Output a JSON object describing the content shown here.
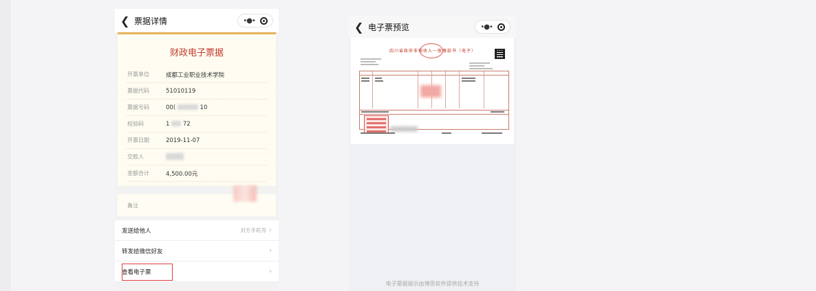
{
  "phone1": {
    "nav": {
      "back_icon": "chevron-left",
      "title": "票据详情"
    },
    "receipt": {
      "title": "财政电子票据",
      "fields": [
        {
          "label": "开票单位",
          "value": "成都工业职业技术学院"
        },
        {
          "label": "票据代码",
          "value": "51010119"
        },
        {
          "label": "票据号码",
          "value_prefix": "00(",
          "value_suffix": "10"
        },
        {
          "label": "校验码",
          "value_prefix": "1",
          "value_suffix": "72"
        },
        {
          "label": "开票日期",
          "value": "2019-11-07"
        },
        {
          "label": "交款人",
          "value": ""
        },
        {
          "label": "金额合计",
          "value": "4,500.00元"
        }
      ],
      "remark_label": "备注"
    },
    "menu": [
      {
        "label": "发送给他人",
        "hint": "对方手机号"
      },
      {
        "label": "转发给微信好友",
        "hint": ""
      },
      {
        "label": "查看电子票",
        "hint": ""
      }
    ],
    "highlight_color": "#e03c3c"
  },
  "phone2": {
    "nav": {
      "back_icon": "chevron-left",
      "title": "电子票预览"
    },
    "invoice": {
      "header": "四川省政府非税收入一般缴款书（电子）"
    },
    "footer": "电子票据展示由博思软件提供技术支持"
  },
  "colors": {
    "accent": "#e6b15a",
    "title_red": "#c0392b"
  }
}
